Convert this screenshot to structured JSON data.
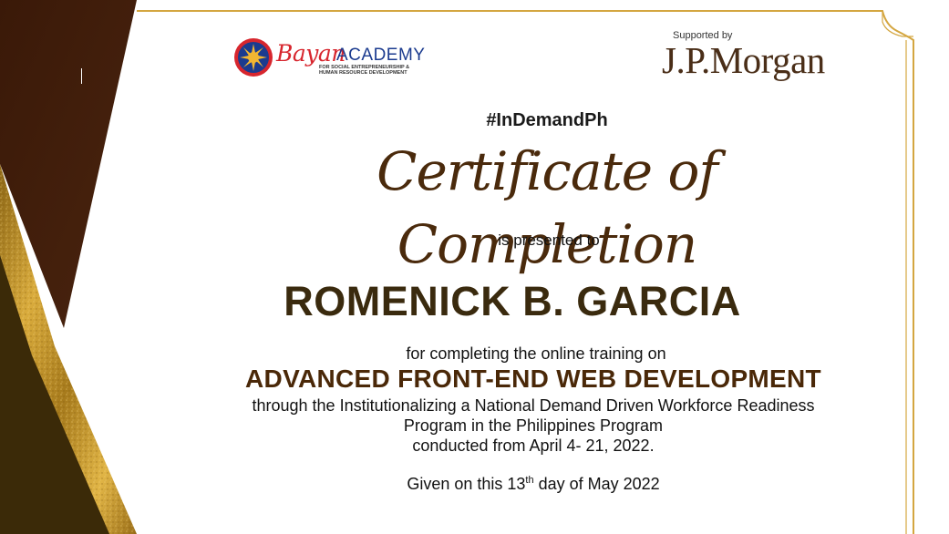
{
  "logos": {
    "bayan_word": "Bayan",
    "academy_word": "ACADEMY",
    "bayan_tagline": "FOR SOCIAL ENTREPRENEURSHIP & HUMAN RESOURCE DEVELOPMENT",
    "supported_by": "Supported by",
    "sponsor": "J.P.Morgan"
  },
  "certificate": {
    "hashtag": "#InDemandPh",
    "title": "Certificate of Completion",
    "presented_to": "is presented to",
    "recipient": "ROMENICK B. GARCIA",
    "completing_text": "for completing the online training on",
    "course": "ADVANCED FRONT-END WEB DEVELOPMENT",
    "program_line1": "through the Institutionalizing a National Demand Driven Workforce Readiness",
    "program_line2": "Program in the Philippines Program",
    "conducted": "conducted from April 4- 21, 2022.",
    "given_prefix": "Given on this 13",
    "given_suffix_sup": "th",
    "given_rest": " day of May 2022"
  },
  "colors": {
    "dark_brown": "#3f1d0b",
    "gold": "#c9971f",
    "frame_gold": "#d4a640",
    "title_brown": "#4a2a0c"
  }
}
